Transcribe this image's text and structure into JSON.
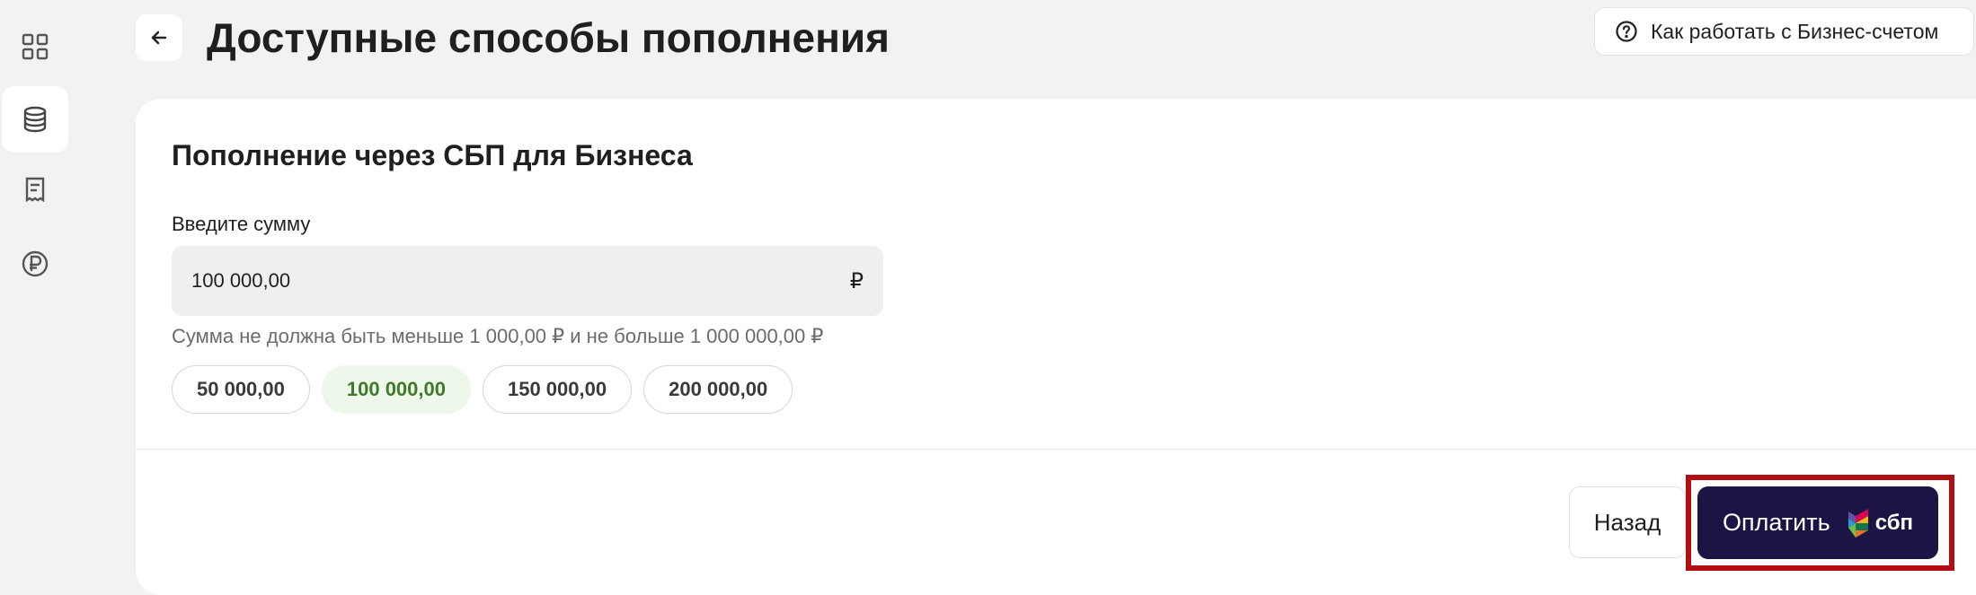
{
  "sidebar": {
    "items": [
      {
        "icon": "dashboard-grid-icon"
      },
      {
        "icon": "database-icon",
        "active": true
      },
      {
        "icon": "receipt-icon"
      },
      {
        "icon": "ruble-coin-icon"
      }
    ]
  },
  "header": {
    "title": "Доступные способы пополнения",
    "help_label": "Как работать с Бизнес-счетом"
  },
  "card": {
    "title": "Пополнение через СБП для Бизнеса",
    "amount_label": "Введите сумму",
    "amount_value": "100 000,00",
    "currency_symbol": "₽",
    "hint": "Сумма не должна быть меньше 1 000,00 ₽ и не больше 1 000 000,00 ₽",
    "chips": [
      {
        "label": "50 000,00",
        "selected": false
      },
      {
        "label": "100 000,00",
        "selected": true
      },
      {
        "label": "150 000,00",
        "selected": false
      },
      {
        "label": "200 000,00",
        "selected": false
      }
    ]
  },
  "footer": {
    "back_label": "Назад",
    "pay_label": "Оплатить",
    "pay_logo_text": "сбп"
  },
  "colors": {
    "page_bg": "#f2f2f2",
    "pay_button": "#1c1445",
    "selected_chip_bg": "#eef8ea",
    "selected_chip_text": "#3d7a2b",
    "highlight_border": "#b20d13"
  }
}
